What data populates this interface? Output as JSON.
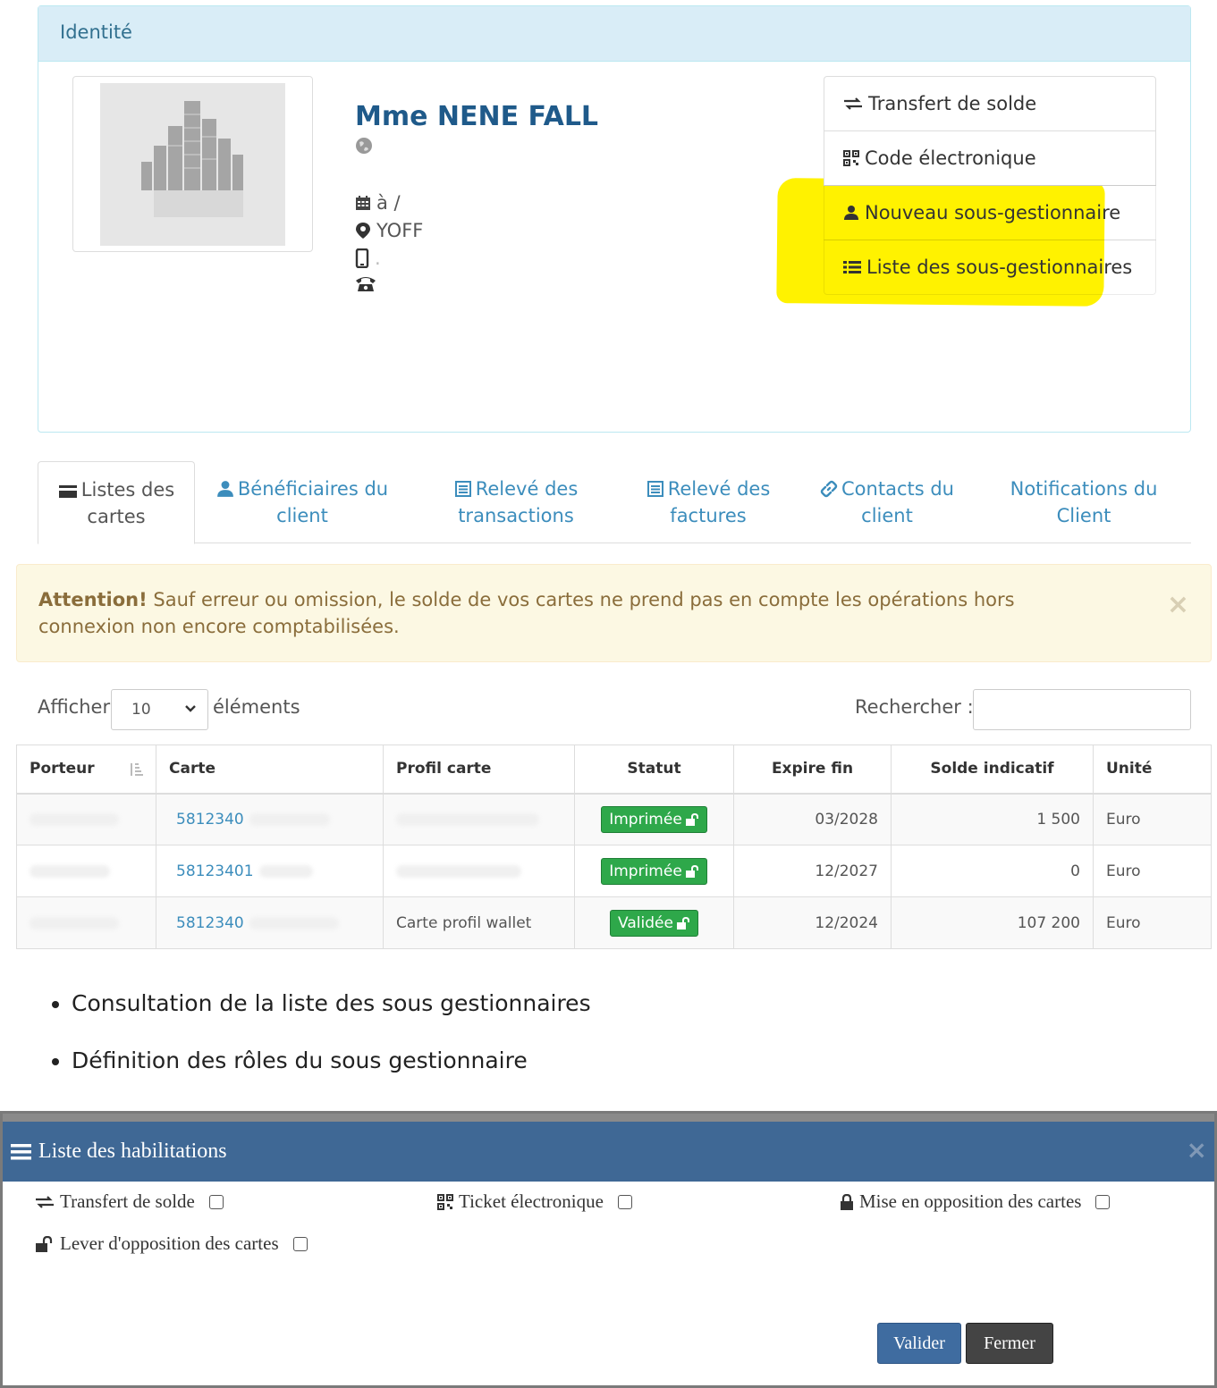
{
  "identity": {
    "heading": "Identité",
    "name": "Mme NENE FALL",
    "birth": "à /",
    "city": "YOFF",
    "mobile": ".",
    "phone": ""
  },
  "actions": [
    {
      "label": "Transfert de solde",
      "icon": "transfer-icon"
    },
    {
      "label": "Code électronique",
      "icon": "qrcode-icon"
    },
    {
      "label": "Nouveau sous-gestionnaire",
      "icon": "user-icon"
    },
    {
      "label": "Liste des sous-gestionnaires",
      "icon": "list-icon"
    }
  ],
  "tabs": [
    {
      "line1": "Listes des",
      "line2": "cartes",
      "icon": "card-icon",
      "active": true
    },
    {
      "line1": "Bénéficiaires du",
      "line2": "client",
      "icon": "user-icon"
    },
    {
      "line1": "Relevé des",
      "line2": "transactions",
      "icon": "document-icon"
    },
    {
      "line1": "Relevé des",
      "line2": "factures",
      "icon": "document-icon"
    },
    {
      "line1": "Contacts du",
      "line2": "client",
      "icon": "link-icon"
    },
    {
      "line1": "Notifications du",
      "line2": "Client",
      "icon": ""
    }
  ],
  "alert": {
    "title": "Attention!",
    "text": " Sauf erreur ou omission, le solde de vos cartes ne prend pas en compte les opérations hors connexion non encore comptabilisées.",
    "close": "×"
  },
  "table_controls": {
    "show_label": "Afficher",
    "page_size": "10",
    "elements_label": "éléments",
    "search_label": "Rechercher :",
    "search_value": ""
  },
  "table": {
    "headers": [
      "Porteur",
      "Carte",
      "Profil carte",
      "Statut",
      "Expire fin",
      "Solde indicatif",
      "Unité"
    ],
    "rows": [
      {
        "porteur": "",
        "carte": "5812340",
        "profil": "",
        "statut": "Imprimée",
        "expire": "03/2028",
        "solde": "1 500",
        "unite": "Euro"
      },
      {
        "porteur": "",
        "carte": "58123401",
        "profil": "",
        "statut": "Imprimée",
        "expire": "12/2027",
        "solde": "0",
        "unite": "Euro"
      },
      {
        "porteur": "",
        "carte": "5812340",
        "profil": "Carte profil wallet",
        "statut": "Validée",
        "expire": "12/2024",
        "solde": "107 200",
        "unite": "Euro"
      }
    ]
  },
  "bullets": [
    "Consultation de la liste des sous gestionnaires",
    "Définition des rôles du sous gestionnaire"
  ],
  "modal": {
    "title": "Liste des habilitations",
    "close": "×",
    "permissions": [
      {
        "label": "Transfert de solde",
        "icon": "transfer-icon",
        "checked": false
      },
      {
        "label": "Ticket électronique",
        "icon": "qrcode-icon",
        "checked": false
      },
      {
        "label": "Mise en opposition des cartes",
        "icon": "lock-icon",
        "checked": false
      },
      {
        "label": "Lever d'opposition des cartes",
        "icon": "unlock-icon",
        "checked": false
      }
    ],
    "validate_label": "Valider",
    "close_label": "Fermer"
  },
  "colors": {
    "panel_heading_bg": "#d9edf7",
    "highlight": "#fff200",
    "badge_green": "#2ea84a",
    "modal_header": "#3f6895",
    "link": "#3c8dbc"
  }
}
